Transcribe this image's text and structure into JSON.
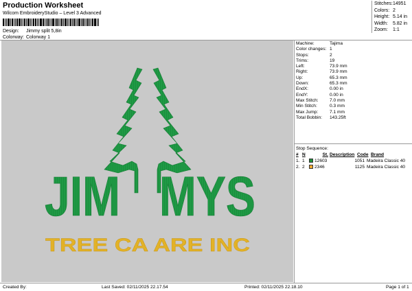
{
  "header": {
    "title": "Production Worksheet",
    "software": "Wilcom EmbroideryStudio – Level 3 Advanced",
    "design_label": "Design:",
    "design_value": "Jimmy split 5,8in",
    "colorway_label": "Colorway:",
    "colorway_value": "Colorway 1"
  },
  "stats": [
    {
      "label": "Stitches:",
      "value": "14951"
    },
    {
      "label": "Colors:",
      "value": "2"
    },
    {
      "label": "Height:",
      "value": "5.14 in"
    },
    {
      "label": "Width:",
      "value": "5.82 in"
    },
    {
      "label": "Zoom:",
      "value": "1:1"
    }
  ],
  "info": [
    {
      "label": "Machine:",
      "value": "Tajima"
    },
    {
      "label": "Color changes:",
      "value": "1"
    },
    {
      "label": "Stops:",
      "value": "2"
    },
    {
      "label": "Trims:",
      "value": "19"
    },
    {
      "label": "Left:",
      "value": "73.9 mm"
    },
    {
      "label": "Right:",
      "value": "73.9 mm"
    },
    {
      "label": "Up:",
      "value": "65.3 mm"
    },
    {
      "label": "Down:",
      "value": "65.3 mm"
    },
    {
      "label": "EndX:",
      "value": "0.00 in"
    },
    {
      "label": "EndY:",
      "value": "0.00 in"
    },
    {
      "label": "Max Stitch:",
      "value": "7.0 mm"
    },
    {
      "label": "Min Stitch:",
      "value": "0.3 mm"
    },
    {
      "label": "Max Jump:",
      "value": "7.1 mm"
    },
    {
      "label": "Total Bobbin:",
      "value": "143.25ft"
    }
  ],
  "sequence": {
    "title": "Stop Sequence:",
    "columns": [
      "#",
      "N",
      "St.",
      "Description",
      "Code",
      "Brand"
    ],
    "rows": [
      {
        "num": "1.",
        "n": "1",
        "color": "#1f8f3a",
        "desc": "12603",
        "stitches": "1051",
        "code": "1051",
        "brand": "Madeira Classic 40"
      },
      {
        "num": "2.",
        "n": "2",
        "color": "#f0a830",
        "desc": "2346",
        "stitches": "1125",
        "code": "1125",
        "brand": "Madeira Classic 40"
      }
    ]
  },
  "design": {
    "line1_left": "JIM",
    "line1_right": "MYS",
    "line2": "TREE CA ARE INC",
    "green": "#1f9a45",
    "gold": "#e7b72a"
  },
  "footer": {
    "created": "Created By:",
    "saved": "Last Saved: 02/11/2025 22.17.54",
    "printed": "Printed: 02/11/2025 22.18.10",
    "page": "Page 1 of 1"
  }
}
